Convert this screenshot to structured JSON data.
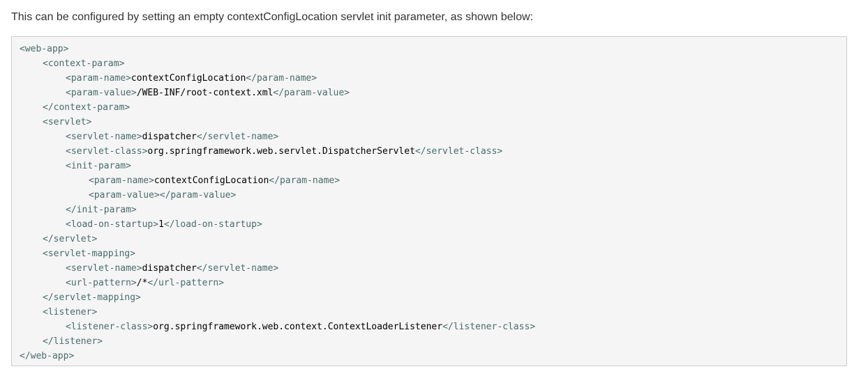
{
  "intro_text": "This can be configured by setting an empty contextConfigLocation servlet init parameter, as shown below:",
  "colors": {
    "tag": "#4a6b6b",
    "text": "#000000",
    "code_background": "#f5f5f5",
    "code_border": "#cccccc"
  },
  "code_lines": [
    {
      "indent": 0,
      "parts": [
        {
          "k": "tag",
          "v": "<web-app>"
        }
      ]
    },
    {
      "indent": 1,
      "parts": [
        {
          "k": "tag",
          "v": "<context-param>"
        }
      ]
    },
    {
      "indent": 2,
      "parts": [
        {
          "k": "tag",
          "v": "<param-name>"
        },
        {
          "k": "text",
          "v": "contextConfigLocation"
        },
        {
          "k": "tag",
          "v": "</param-name>"
        }
      ]
    },
    {
      "indent": 2,
      "parts": [
        {
          "k": "tag",
          "v": "<param-value>"
        },
        {
          "k": "text",
          "v": "/WEB-INF/root-context.xml"
        },
        {
          "k": "tag",
          "v": "</param-value>"
        }
      ]
    },
    {
      "indent": 1,
      "parts": [
        {
          "k": "tag",
          "v": "</context-param>"
        }
      ]
    },
    {
      "indent": 1,
      "parts": [
        {
          "k": "tag",
          "v": "<servlet>"
        }
      ]
    },
    {
      "indent": 2,
      "parts": [
        {
          "k": "tag",
          "v": "<servlet-name>"
        },
        {
          "k": "text",
          "v": "dispatcher"
        },
        {
          "k": "tag",
          "v": "</servlet-name>"
        }
      ]
    },
    {
      "indent": 2,
      "parts": [
        {
          "k": "tag",
          "v": "<servlet-class>"
        },
        {
          "k": "text",
          "v": "org.springframework.web.servlet.DispatcherServlet"
        },
        {
          "k": "tag",
          "v": "</servlet-class>"
        }
      ]
    },
    {
      "indent": 2,
      "parts": [
        {
          "k": "tag",
          "v": "<init-param>"
        }
      ]
    },
    {
      "indent": 3,
      "parts": [
        {
          "k": "tag",
          "v": "<param-name>"
        },
        {
          "k": "text",
          "v": "contextConfigLocation"
        },
        {
          "k": "tag",
          "v": "</param-name>"
        }
      ]
    },
    {
      "indent": 3,
      "parts": [
        {
          "k": "tag",
          "v": "<param-value></param-value>"
        }
      ]
    },
    {
      "indent": 2,
      "parts": [
        {
          "k": "tag",
          "v": "</init-param>"
        }
      ]
    },
    {
      "indent": 2,
      "parts": [
        {
          "k": "tag",
          "v": "<load-on-startup>"
        },
        {
          "k": "text",
          "v": "1"
        },
        {
          "k": "tag",
          "v": "</load-on-startup>"
        }
      ]
    },
    {
      "indent": 1,
      "parts": [
        {
          "k": "tag",
          "v": "</servlet>"
        }
      ]
    },
    {
      "indent": 1,
      "parts": [
        {
          "k": "tag",
          "v": "<servlet-mapping>"
        }
      ]
    },
    {
      "indent": 2,
      "parts": [
        {
          "k": "tag",
          "v": "<servlet-name>"
        },
        {
          "k": "text",
          "v": "dispatcher"
        },
        {
          "k": "tag",
          "v": "</servlet-name>"
        }
      ]
    },
    {
      "indent": 2,
      "parts": [
        {
          "k": "tag",
          "v": "<url-pattern>"
        },
        {
          "k": "text",
          "v": "/*"
        },
        {
          "k": "tag",
          "v": "</url-pattern>"
        }
      ]
    },
    {
      "indent": 1,
      "parts": [
        {
          "k": "tag",
          "v": "</servlet-mapping>"
        }
      ]
    },
    {
      "indent": 1,
      "parts": [
        {
          "k": "tag",
          "v": "<listener>"
        }
      ]
    },
    {
      "indent": 2,
      "parts": [
        {
          "k": "tag",
          "v": "<listener-class>"
        },
        {
          "k": "text",
          "v": "org.springframework.web.context.ContextLoaderListener"
        },
        {
          "k": "tag",
          "v": "</listener-class>"
        }
      ]
    },
    {
      "indent": 1,
      "parts": [
        {
          "k": "tag",
          "v": "</listener>"
        }
      ]
    },
    {
      "indent": 0,
      "parts": [
        {
          "k": "tag",
          "v": "</web-app>"
        }
      ]
    }
  ]
}
